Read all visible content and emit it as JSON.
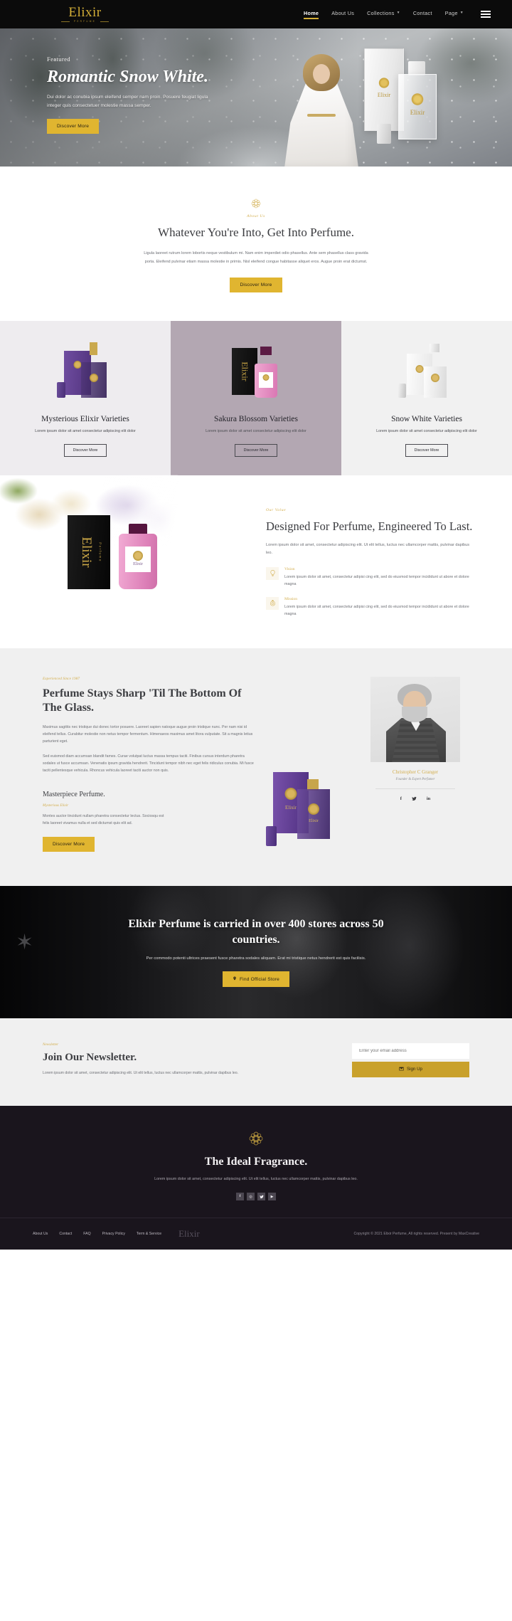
{
  "header": {
    "brand": {
      "name": "Elixir",
      "sub": "Perfume"
    },
    "nav": [
      {
        "label": "Home",
        "active": true,
        "caret": false
      },
      {
        "label": "About Us",
        "active": false,
        "caret": false
      },
      {
        "label": "Collections",
        "active": false,
        "caret": true
      },
      {
        "label": "Contact",
        "active": false,
        "caret": false
      },
      {
        "label": "Page",
        "active": false,
        "caret": true
      }
    ],
    "menu_icon": "hamburger-icon"
  },
  "hero": {
    "eyebrow": "Featured",
    "title": "Romantic Snow White.",
    "desc": "Dui dolor ac conubia ipsum eleifend semper nam proin. Posuere feugiat ligula integer quis consectetuer molestie massa semper.",
    "cta": "Discover More",
    "product_label": "Elixir"
  },
  "about": {
    "eyebrow": "About Us",
    "title": "Whatever You're Into, Get Into Perfume.",
    "body": "Ligula laoreet rutrum lorem lobortis neque vestibulum mi. Nam enim imperdiet odio phasellus. Ante sem phasellus class gravida porta. Eleifend pulvinar etiam massa molestie in primis. Nisl eleifend congue habitasse aliquet eros. Augue proin erat dictumst.",
    "cta": "Discover More"
  },
  "cards": [
    {
      "title": "Mysterious Elixir Varieties",
      "desc": "Lorem ipsum dolor sit amet consectetur adipiscing elit dolor",
      "cta": "Discover More"
    },
    {
      "title": "Sakura Blossom Varieties",
      "desc": "Lorem ipsum dolor sit amet consectetur adipiscing elit dolor",
      "cta": "Discover More"
    },
    {
      "title": "Snow White Varieties",
      "desc": "Lorem ipsum dolor sit amet consectetur adipiscing elit dolor",
      "cta": "Discover More"
    }
  ],
  "value": {
    "eyebrow": "Our Value",
    "title": "Designed For Perfume, Engineered To Last.",
    "lead": "Lorem ipsum dolor sit amet, consectetur adipiscing elit. Ut elit tellus, luctus nec ullamcorper mattis, pulvinar dapibus leo.",
    "features": [
      {
        "title": "Vision",
        "desc": "Lorem ipsum dolor sit amet, consectetur adipisi cing elit, sed do eiusmod tempor incididunt ut abore et dolore magna",
        "icon": "lightbulb-icon"
      },
      {
        "title": "Mission",
        "desc": "Lorem ipsum dolor sit amet, consectetur adipisi cing elit, sed do eiusmod tempor incididunt ut abore et dolore magna",
        "icon": "target-icon"
      }
    ],
    "product_brand": "Elixir",
    "product_sub": "Perfume",
    "bottle_label": "Elixir"
  },
  "about_long": {
    "eyebrow": "Experienced Since 1987",
    "title": "Perfume Stays Sharp 'Til The Bottom Of The Glass.",
    "p1": "Maximus sagittis nec tristique dui donec tortor posuere. Laoreet sapien natoque augue proin tristique nunc. Per nam nisi id eleifend tellus. Curabitur molestie non netus tempor fermentum. Himenaeos maximus amet litora vulputate. Sit a magnis letius parturient eget.",
    "p2": "Sed euismod diam accumsan blandit fames. Curae volutpat luctus massa tempus taciti. Finibus cursus interdum pharetra sodales ut fusce accumsan. Venenatis ipsum gravida hendrerit. Tincidunt tempor nibh nec eget felis ridiculus conubia. Mi fusce taciti pellentesque vehicula. Rhoncus vehicula laoreet taciti auctor non quis.",
    "subtitle": "Masterpiece Perfume.",
    "sub_eyebrow": "Mysterious Elixir",
    "sub_body": "Montes auctor tincidunt nullam pharetra consectetur lectus. Sociosqu est felis laoreet vivamus nulla et sed dictumst quis elit ad.",
    "cta": "Discover More",
    "product_brand": "Elixir",
    "author_name": "Christopher C Granger",
    "author_role": "Founder & Expert Perfumer",
    "socials": [
      {
        "name": "facebook-icon",
        "glyph": "f"
      },
      {
        "name": "twitter-icon",
        "glyph": "🐦"
      },
      {
        "name": "linkedin-icon",
        "glyph": "in"
      }
    ]
  },
  "stores": {
    "title": "Elixir Perfume is carried in over 400 stores across 50 countries.",
    "desc": "Per commodo potenti ultrices praesent fusce pharetra sodales aliquam. Erat mi tristique netus hendrerit est quis facilisis.",
    "cta": "Find Official Store",
    "cta_icon": "map-pin-icon"
  },
  "newsletter": {
    "eyebrow": "Newsletter",
    "title": "Join Our Newsletter.",
    "desc": "Lorem ipsum dolor sit amet, consectetur adipiscing elit. Ut elit tellus, luctus nec ullamcorper mattis, pulvinar dapibus leo.",
    "placeholder": "Enter your email address",
    "button": "Sign Up",
    "button_icon": "envelope-icon"
  },
  "footer": {
    "title": "The Ideal Fragrance.",
    "desc": "Lorem ipsum dolor sit amet, consectetur adipiscing elit. Ut elit tellus, luctus nec ullamcorper mattis, pulvinar dapibus leo.",
    "socials": [
      {
        "name": "facebook-icon",
        "glyph": "f"
      },
      {
        "name": "instagram-icon",
        "glyph": "◎"
      },
      {
        "name": "twitter-icon",
        "glyph": "t"
      },
      {
        "name": "youtube-icon",
        "glyph": "▶"
      }
    ],
    "links": [
      "About Us",
      "Contact",
      "FAQ",
      "Privacy Policy",
      "Term & Service"
    ],
    "brand": "Elixir",
    "copyright": "Copyright © 2021 Elixir Perfume, All rights reserved. Present by MaxCreative"
  },
  "colors": {
    "gold": "#d4af37",
    "gold_button": "#e0b530",
    "gold_dark": "#c9a12c",
    "dark": "#0b0b0b",
    "footer_dark": "#1a151d",
    "card2_bg": "#b3a7b2"
  }
}
